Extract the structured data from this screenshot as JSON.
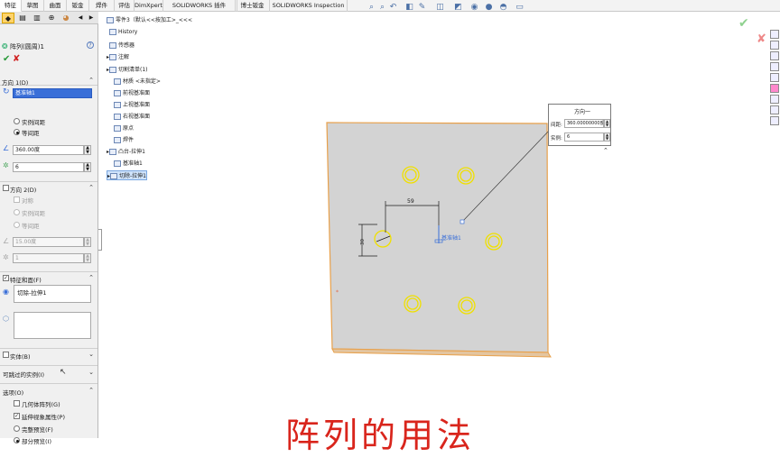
{
  "ribbon": {
    "tabs": [
      {
        "label": "特征",
        "active": true
      },
      {
        "label": "草图"
      },
      {
        "label": "曲面"
      },
      {
        "label": "钣金"
      },
      {
        "label": "焊件"
      },
      {
        "label": "评估"
      },
      {
        "label": "DimXpert"
      },
      {
        "label": "SOLIDWORKS 插件"
      },
      {
        "label": "博士钣金"
      },
      {
        "label": "SOLIDWORKS Inspection"
      }
    ]
  },
  "property_manager": {
    "title": "阵列(圆周)1",
    "ok_icon": "checkmark-icon",
    "cancel_icon": "close-icon",
    "direction1": {
      "header": "方向 1(D)",
      "axis_value": "基准轴1",
      "radio_instance_spacing": "实例间距",
      "radio_equal_spacing": "等间距",
      "angle_value": "360.00度",
      "count_value": "6"
    },
    "direction2": {
      "header": "方向 2(D)",
      "symmetric": "对称",
      "radio_instance_spacing": "实例间距",
      "radio_equal_spacing": "等间距",
      "angle_value": "15.00度",
      "count_value": "1"
    },
    "features_faces": {
      "header": "特征和面(F)",
      "feature_item": "切除-拉伸1"
    },
    "bodies": {
      "header": "实体(B)"
    },
    "instances_to_skip": {
      "header": "可跳过的实例(I)"
    },
    "options": {
      "header": "选项(O)",
      "geometry_pattern": "几何体阵列(G)",
      "propagate_visual": "延伸视象属性(P)",
      "full_preview": "完整预览(F)",
      "partial_preview": "部分预览(I)"
    }
  },
  "feature_tree": {
    "root": "零件3（默认<<按加工>_<<<",
    "items": [
      {
        "label": "History"
      },
      {
        "label": "传感器"
      },
      {
        "label": "注解"
      },
      {
        "label": "切割清单(1)"
      },
      {
        "label": "材质 <未指定>"
      },
      {
        "label": "前视基准面"
      },
      {
        "label": "上视基准面"
      },
      {
        "label": "右视基准面"
      },
      {
        "label": "原点"
      },
      {
        "label": "焊件"
      },
      {
        "label": "凸台-拉伸1"
      },
      {
        "label": "基准轴1"
      },
      {
        "label": "切除-拉伸1"
      }
    ]
  },
  "callout": {
    "header": "方向一",
    "angle_label": "间距:",
    "angle_value": "360.00000000度",
    "count_label": "实例:",
    "count_value": "6"
  },
  "graphics": {
    "dimension_horizontal": "59",
    "dimension_vertical": "30",
    "dimension_diameter": "Ø16",
    "axis_label": "基准轴1"
  },
  "subtitle": "阵列的用法",
  "colors": {
    "accent_orange": "#e8a04a",
    "plate_fill": "#d4d4d4",
    "preview_yellow": "#f0e000",
    "subtitle_red": "#d9251c",
    "selection_blue": "#3a6fd8"
  }
}
